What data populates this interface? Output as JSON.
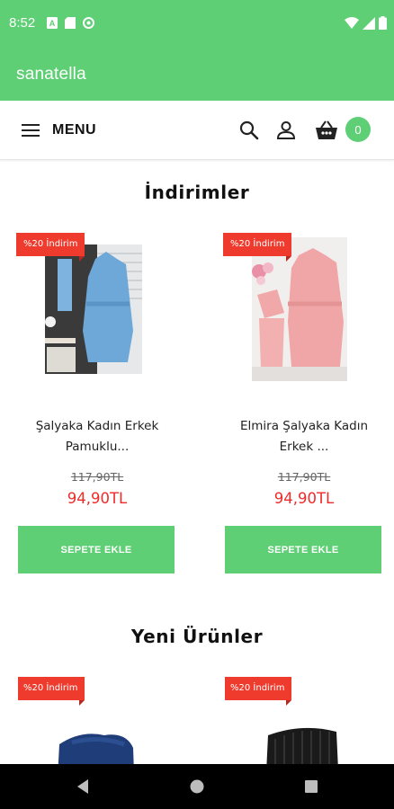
{
  "status_bar": {
    "time": "8:52"
  },
  "app_bar": {
    "title": "sanatella"
  },
  "nav": {
    "menu_label": "MENU",
    "cart_count": "0"
  },
  "sections": {
    "discounts": {
      "title": "İndirimler",
      "products": [
        {
          "tag": "%20 İndirim",
          "name_line1": "Şalyaka Kadın Erkek",
          "name_line2": "Pamuklu...",
          "old_price": "117,90TL",
          "new_price": "94,90TL",
          "button": "SEPETE EKLE"
        },
        {
          "tag": "%20 İndirim",
          "name_line1": "Elmira Şalyaka Kadın",
          "name_line2": "Erkek ...",
          "old_price": "117,90TL",
          "new_price": "94,90TL",
          "button": "SEPETE EKLE"
        }
      ]
    },
    "new_products": {
      "title": "Yeni Ürünler",
      "products": [
        {
          "tag": "%20 İndirim"
        },
        {
          "tag": "%20 İndirim"
        }
      ]
    }
  },
  "colors": {
    "brand_green": "#5ecf74",
    "sale_red": "#ef3b2d",
    "price_red": "#ee2b2b"
  },
  "icons": [
    "hamburger-icon",
    "search-icon",
    "account-icon",
    "basket-icon",
    "back-icon",
    "home-icon",
    "recents-icon"
  ]
}
